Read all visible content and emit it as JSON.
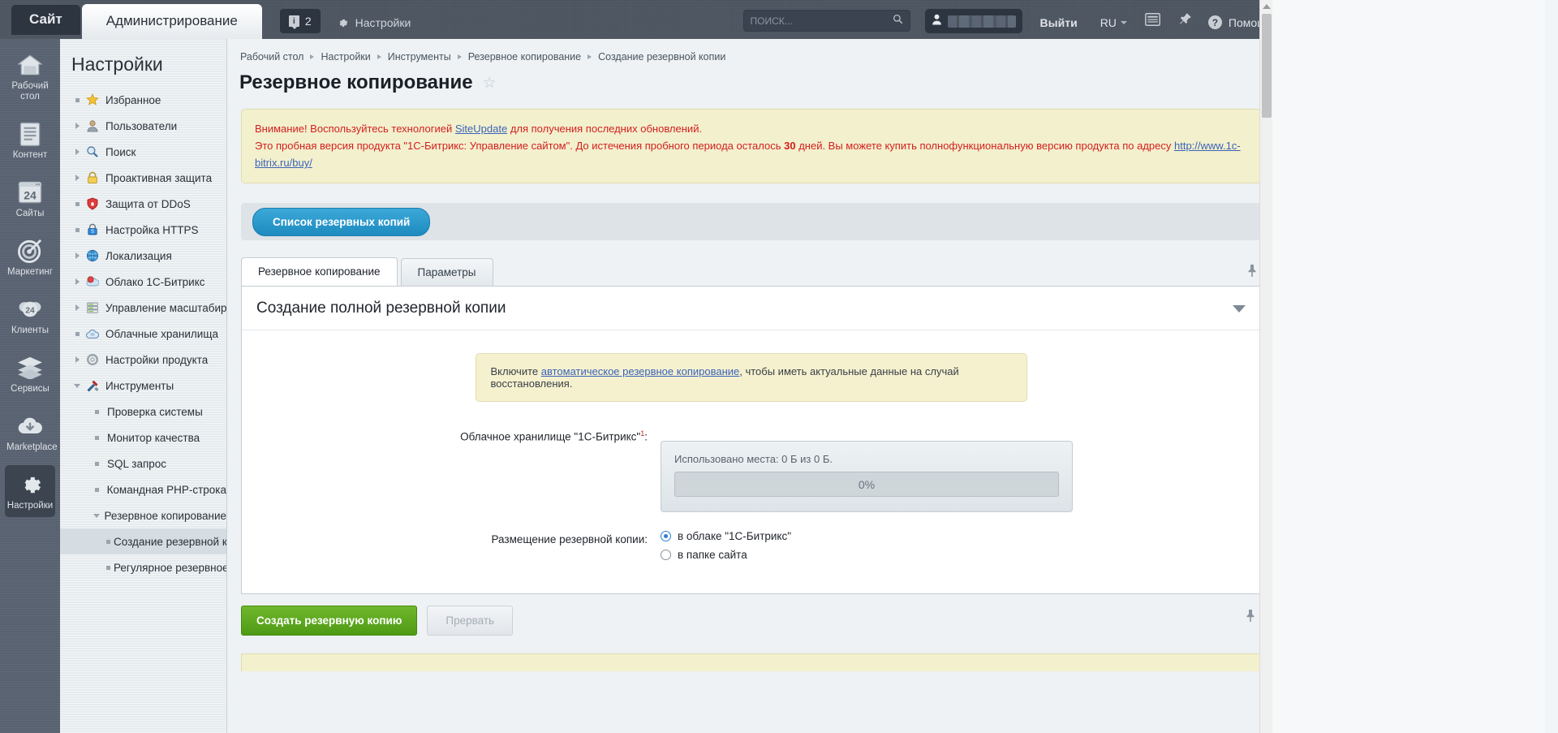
{
  "topbar": {
    "tab_site": "Сайт",
    "tab_admin": "Администрирование",
    "notif_count": "2",
    "settings_label": "Настройки",
    "search_placeholder": "поиск...",
    "search_value": "",
    "logout": "Выйти",
    "lang": "RU",
    "help": "Помощь"
  },
  "rail": {
    "items": [
      {
        "label": "Рабочий стол",
        "icon": "home-icon",
        "active": false
      },
      {
        "label": "Контент",
        "icon": "document-icon",
        "active": false
      },
      {
        "label": "Сайты",
        "icon": "sites-24-icon",
        "active": false
      },
      {
        "label": "Маркетинг",
        "icon": "target-icon",
        "active": false
      },
      {
        "label": "Клиенты",
        "icon": "clients-24-icon",
        "active": false
      },
      {
        "label": "Сервисы",
        "icon": "layers-icon",
        "active": false
      },
      {
        "label": "Marketplace",
        "icon": "cloud-download-icon",
        "active": false
      },
      {
        "label": "Настройки",
        "icon": "gear-icon",
        "active": true
      }
    ]
  },
  "tree": {
    "title": "Настройки",
    "items": [
      {
        "label": "Избранное",
        "marker": "dot",
        "icon": "star-icon",
        "level": 0,
        "selected": false
      },
      {
        "label": "Пользователи",
        "marker": "arrow-r",
        "icon": "user-icon",
        "level": 0,
        "selected": false
      },
      {
        "label": "Поиск",
        "marker": "arrow-r",
        "icon": "magnifier-icon",
        "level": 0,
        "selected": false
      },
      {
        "label": "Проактивная защита",
        "marker": "arrow-r",
        "icon": "lock-icon",
        "level": 0,
        "selected": false
      },
      {
        "label": "Защита от DDoS",
        "marker": "dot",
        "icon": "shield-icon",
        "level": 0,
        "selected": false
      },
      {
        "label": "Настройка HTTPS",
        "marker": "dot",
        "icon": "https-lock-icon",
        "level": 0,
        "selected": false
      },
      {
        "label": "Локализация",
        "marker": "arrow-r",
        "icon": "globe-icon",
        "level": 0,
        "selected": false
      },
      {
        "label": "Облако 1С-Битрикс",
        "marker": "arrow-r",
        "icon": "cloud-red-icon",
        "level": 0,
        "selected": false
      },
      {
        "label": "Управление масштабирова",
        "marker": "arrow-r",
        "icon": "server-icon",
        "level": 0,
        "selected": false
      },
      {
        "label": "Облачные хранилища",
        "marker": "dot",
        "icon": "cloud-storage-icon",
        "level": 0,
        "selected": false
      },
      {
        "label": "Настройки продукта",
        "marker": "arrow-r",
        "icon": "gear-grey-icon",
        "level": 0,
        "selected": false
      },
      {
        "label": "Инструменты",
        "marker": "arrow-d",
        "icon": "tools-icon",
        "level": 0,
        "selected": false
      },
      {
        "label": "Проверка системы",
        "marker": "dot",
        "icon": "",
        "level": 1,
        "selected": false
      },
      {
        "label": "Монитор качества",
        "marker": "dot",
        "icon": "",
        "level": 1,
        "selected": false
      },
      {
        "label": "SQL запрос",
        "marker": "dot",
        "icon": "",
        "level": 1,
        "selected": false
      },
      {
        "label": "Командная PHP-строка",
        "marker": "dot",
        "icon": "",
        "level": 1,
        "selected": false
      },
      {
        "label": "Резервное копирование",
        "marker": "arrow-d",
        "icon": "",
        "level": 1,
        "selected": false
      },
      {
        "label": "Создание резервной ко",
        "marker": "dot",
        "icon": "",
        "level": 2,
        "selected": true
      },
      {
        "label": "Регулярное резервное",
        "marker": "dot",
        "icon": "",
        "level": 2,
        "selected": false
      }
    ]
  },
  "breadcrumb": [
    "Рабочий стол",
    "Настройки",
    "Инструменты",
    "Резервное копирование",
    "Создание резервной копии"
  ],
  "page": {
    "title": "Резервное копирование",
    "favorite_star": "☆"
  },
  "notice": {
    "line1_a": "Внимание! Воспользуйтесь технологией ",
    "line1_link": "SiteUpdate",
    "line1_b": " для получения последних обновлений.",
    "line2_a": "Это пробная версия продукта \"1С-Битрикс: Управление сайтом\". До истечения пробного периода осталось ",
    "line2_days": "30",
    "line2_b": " дней. Вы можете купить полнофункциональную версию продукта по адресу ",
    "line2_link": "http://www.1c-bitrix.ru/buy/"
  },
  "toolbar": {
    "backup_list_button": "Список резервных копий"
  },
  "tabs": [
    {
      "label": "Резервное копирование",
      "active": true
    },
    {
      "label": "Параметры",
      "active": false
    }
  ],
  "panel": {
    "heading": "Создание полной резервной копии",
    "inner_notice_a": "Включите ",
    "inner_notice_link": "автоматическое резервное копирование",
    "inner_notice_b": ", чтобы иметь актуальные данные на случай восстановления.",
    "cloud_label": "Облачное хранилище \"1С-Битрикс\"",
    "cloud_label_sup": "1",
    "cloud_label_colon": ":",
    "quota_text": "Использовано места: 0 Б из 0 Б.",
    "quota_percent": "0%",
    "placement_label": "Размещение резервной копии:",
    "placement_options": [
      {
        "label": "в облаке \"1С-Битрикс\"",
        "selected": true
      },
      {
        "label": "в папке сайта",
        "selected": false
      }
    ]
  },
  "actions": {
    "create_button": "Создать резервную копию",
    "abort_button": "Прервать"
  },
  "colors": {
    "accent_blue": "#2b8cc4",
    "green": "#5ca81d",
    "warning_bg": "#f3f0cd",
    "warning_text": "#d32020",
    "topbar": "#4c5561"
  }
}
